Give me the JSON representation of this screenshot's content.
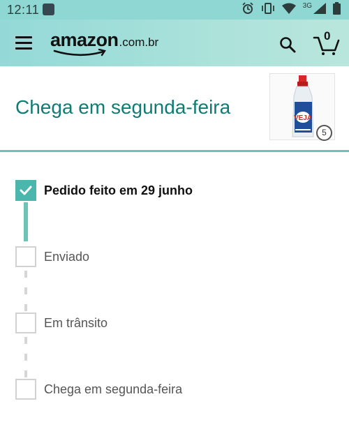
{
  "status_bar": {
    "time": "12:11",
    "network": "3G",
    "icons": [
      "notification-icon",
      "alarm-icon",
      "vibrate-icon",
      "wifi-icon",
      "signal-icon",
      "battery-icon"
    ]
  },
  "header": {
    "logo_text": "amazon",
    "logo_domain": ".com.br",
    "cart_count": "0",
    "icons": [
      "menu-icon",
      "search-icon",
      "cart-icon"
    ]
  },
  "delivery": {
    "title": "Chega em segunda-feira",
    "product": {
      "brand_on_label": "VEJA",
      "quantity": "5"
    }
  },
  "timeline": {
    "steps": [
      {
        "label": "Pedido feito em 29 junho",
        "done": true
      },
      {
        "label": "Enviado",
        "done": false
      },
      {
        "label": "Em trânsito",
        "done": false
      },
      {
        "label": "Chega em segunda-feira",
        "done": false
      }
    ]
  },
  "colors": {
    "header_bg": "#9edcd8",
    "accent": "#0f7c73",
    "step_done": "#4bb7ac",
    "step_pending_border": "#d2d2d2"
  }
}
